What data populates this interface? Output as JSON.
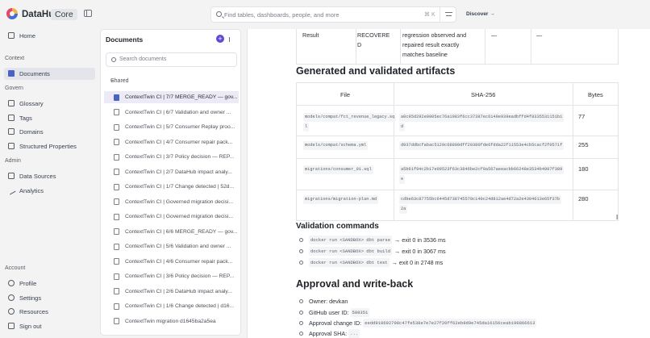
{
  "app": {
    "brand": "DataHub",
    "edition": "Core"
  },
  "topbar": {
    "search_placeholder": "Find tables, dashboards, people, and more",
    "search_shortcut": "⌘ K",
    "discover_label": "Discover →"
  },
  "nav": {
    "home": "Home",
    "context_section": "Context",
    "documents": "Documents",
    "govern_section": "Govern",
    "glossary": "Glossary",
    "tags": "Tags",
    "domains": "Domains",
    "structured_properties": "Structured Properties",
    "admin_section": "Admin",
    "data_sources": "Data Sources",
    "analytics": "Analytics",
    "account_section": "Account",
    "profile": "Profile",
    "settings": "Settings",
    "resources": "Resources",
    "sign_out": "Sign out"
  },
  "documents_panel": {
    "title": "Documents",
    "search_placeholder": "Search documents",
    "shared_label": "Shared",
    "items": [
      "ContextTwin CI | 7/7 MERGE_READY — gov...",
      "ContextTwin CI | 6/7 Validation and owner ...",
      "ContextTwin CI | 5/7 Consumer Replay proo...",
      "ContextTwin CI | 4/7 Consumer repair pack...",
      "ContextTwin CI | 3/7 Policy decision — REP...",
      "ContextTwin CI | 2/7 DataHub impact analy...",
      "ContextTwin CI | 1/7 Change detected | 52d...",
      "ContextTwin CI | Governed migration decisi...",
      "ContextTwin CI | Governed migration decisi...",
      "ContextTwin CI | 6/6 MERGE_READY — gov...",
      "ContextTwin CI | 5/6 Validation and owner ...",
      "ContextTwin CI | 4/6 Consumer repair pack...",
      "ContextTwin CI | 3/6 Policy decision — REP...",
      "ContextTwin CI | 2/6 DataHub impact analy...",
      "ContextTwin CI | 1/6 Change detected | d16...",
      "ContextTwin migration d1645ba2a5ea"
    ]
  },
  "main": {
    "result_row": {
      "label": "Result",
      "value_line1": "RECOVERE",
      "value_line2": "D",
      "desc_line1": "regression observed and",
      "desc_line2": "repaired result exactly",
      "desc_line3": "matches baseline",
      "col4": "—",
      "col5": "—"
    },
    "artifacts_heading": "Generated and validated artifacts",
    "artifacts_headers": {
      "file": "File",
      "sha": "SHA-256",
      "bytes": "Bytes"
    },
    "artifacts": [
      {
        "file_1": "models/compat/fct_revenue_legacy.sq",
        "file_2": "l",
        "sha_1": "a0c95d292e0005ec76a1983f6cc37387ec6149e939eadbffd4f8335531151b1",
        "sha_2": "d",
        "bytes": "77"
      },
      {
        "file_1": "models/compat/schema.yml",
        "file_2": "",
        "sha_1": "d937ddbcfabac5129c68809dff20380fde6fdda22f11553e4cb5cacf2f0571f",
        "sha_2": "",
        "bytes": "255"
      },
      {
        "file_1": "migrations/consumer_01.sql",
        "file_2": "",
        "sha_1": "a5b61f94c2b17e09523f63c3846be2cf9a567aeeacbb66248e3534b4997f389",
        "sha_2": "e",
        "bytes": "180"
      },
      {
        "file_1": "migrations/migration-plan.md",
        "file_2": "",
        "sha_1": "cdbe63c87755bc6445d738745570c140c24d812ae4d72a2e4304613e65f37b",
        "sha_2": "2a",
        "bytes": "280"
      }
    ],
    "validation_heading": "Validation commands",
    "validation": [
      {
        "cmd": "docker run <SANDBOX> dbt parse",
        "result": "→ exit 0 in 3536 ms"
      },
      {
        "cmd": "docker run <SANDBOX> dbt build",
        "result": "→ exit 0 in 3067 ms"
      },
      {
        "cmd": "docker run <SANDBOX> dbt test",
        "result": "→ exit 0 in 2748 ms"
      }
    ],
    "approval_heading": "Approval and write-back",
    "approval": {
      "owner": "Owner: devkan",
      "github_label": "GitHub user ID:",
      "github_id": "589351",
      "change_label": "Approval change ID:",
      "change_id": "eedd910692798c47fe538e7e7e27f20ff62eb9d9e745da16156ceab199866613",
      "sha_label": "Approval SHA:",
      "sha_value": "..."
    }
  },
  "colors": {
    "accent": "#5b4bd8",
    "active_bg": "#e3e5ea",
    "doc_icon": "#4a62c8"
  }
}
